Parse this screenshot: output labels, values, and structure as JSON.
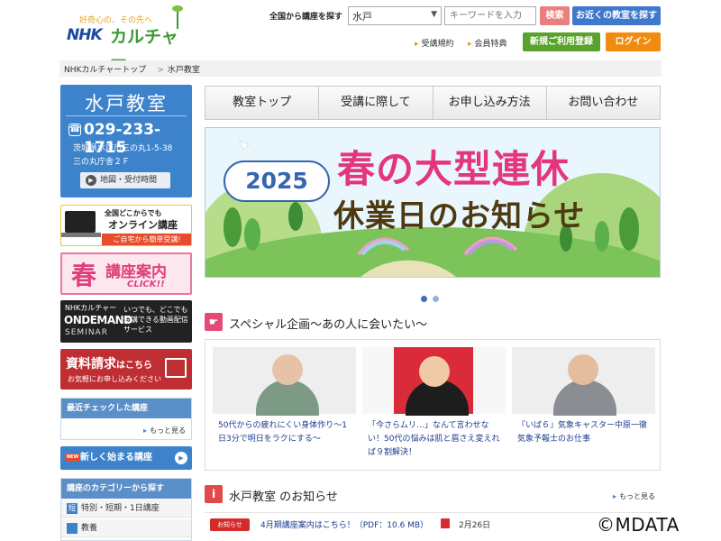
{
  "header": {
    "logo_tagline": "好奇心の、その先へ",
    "logo_brand": "NHK",
    "logo_brand2": "カルチャー",
    "search_label": "全国から講座を探す",
    "area_selected": "水戸",
    "keyword_placeholder": "キーワードを入力",
    "search_button": "検索",
    "nearby_button": "お近くの教室を探す",
    "terms_link": "受講規約",
    "member_link": "会員特典",
    "register_button": "新規ご利用登録",
    "login_button": "ログイン"
  },
  "breadcrumb": {
    "home": "NHKカルチャートップ",
    "current": "水戸教室"
  },
  "sidebar": {
    "classroom_title": "水戸教室",
    "phone": "029-233-1715",
    "address_line1": "茨城県水戸市三の丸1-5-38",
    "address_line2": "三の丸庁舎２Ｆ",
    "map_button": "地図・受付時間",
    "online_banner": {
      "line1": "全国どこからでも",
      "line2": "オンライン講座",
      "line3": "ご自宅から簡単受講!"
    },
    "spring_banner": {
      "big": "春",
      "text": "講座案内",
      "click": "CLICK!!"
    },
    "ondemand_banner": {
      "line1": "NHKカルチャー",
      "line2": "ONDEMAND",
      "line3": "SEMINAR",
      "desc": "いつでも、どこでも受講できる動画配信サービス"
    },
    "brochure_banner": {
      "title": "資料請求",
      "suffix": "はこちら",
      "sub": "お気軽にお申し込みください"
    },
    "recent_title": "最近チェックした講座",
    "recent_more": "もっと見る",
    "new_badge": "NEW",
    "new_courses": "新しく始まる講座",
    "category_title": "講座のカテゴリーから探す",
    "categories": [
      {
        "icon": "短",
        "label": "特別・短期・1日講座"
      },
      {
        "icon": "",
        "label": "教養"
      }
    ]
  },
  "nav": [
    "教室トップ",
    "受講に際して",
    "お申し込み方法",
    "お問い合わせ"
  ],
  "hero": {
    "year": "2025",
    "title": "春の大型連休",
    "subtitle": "休業日のお知らせ"
  },
  "special": {
    "title": "スペシャル企画～あの人に会いたい～",
    "cards": [
      {
        "caption": "50代からの疲れにくい身体作り～1日3分で明日をラクにする～"
      },
      {
        "caption": "「今さらムリ…」なんて言わせない！50代の悩みは肌と眉さえ変えれば９割解決！"
      },
      {
        "caption": "『いば６』気象キャスター中原一徹　気象予報士のお仕事"
      }
    ]
  },
  "news": {
    "title": "水戸教室 のお知らせ",
    "more": "もっと見る",
    "badge": "お知らせ",
    "item_text": "4月期講座案内はこちら！（PDF：10.6 MB）",
    "item_date": "2月26日"
  },
  "watermark": "©MDATA",
  "colors": {
    "primary": "#3d83cc",
    "accent_pink": "#e3367c",
    "green": "#5aa22e",
    "orange": "#f08d11"
  }
}
